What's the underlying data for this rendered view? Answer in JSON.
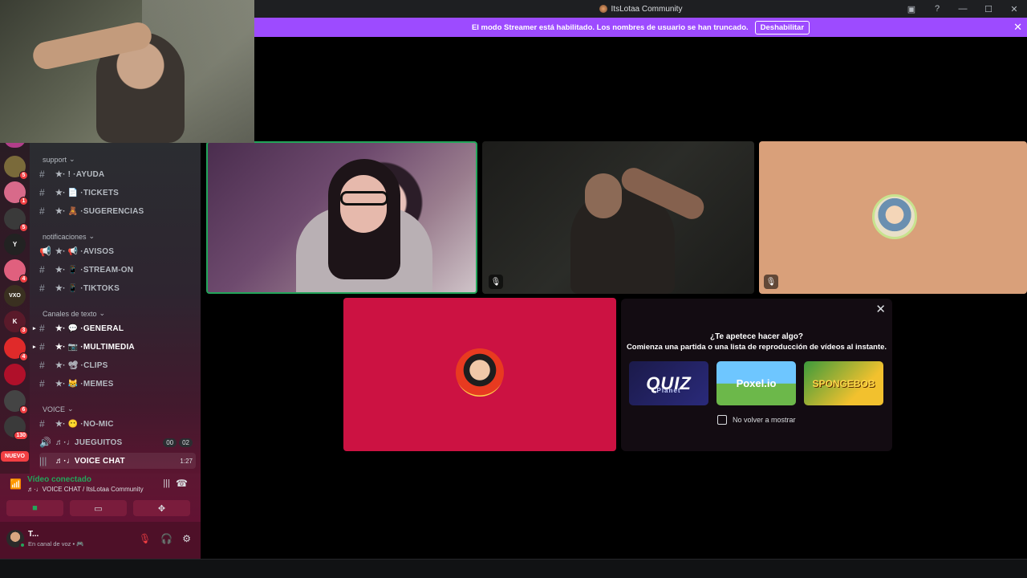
{
  "window": {
    "title": "ItsLotaa Community"
  },
  "banner": {
    "message": "El modo Streamer está habilitado. Los nombres de usuario se han truncado.",
    "button": "Deshabilitar"
  },
  "server_rail": {
    "servers": [
      {
        "initials": "",
        "badge": "",
        "color": "#b23e8a"
      },
      {
        "initials": "",
        "badge": "5",
        "color": "#7a6a3a"
      },
      {
        "initials": "",
        "badge": "1",
        "color": "#d86a8a"
      },
      {
        "initials": "",
        "badge": "5",
        "color": "#3a3a3a"
      },
      {
        "initials": "Y",
        "badge": "",
        "color": "#222222"
      },
      {
        "initials": "",
        "badge": "4",
        "color": "#e0607e"
      },
      {
        "initials": "VXO",
        "badge": "",
        "color": "#3a3020"
      },
      {
        "initials": "K",
        "badge": "3",
        "color": "#5a1a2a"
      },
      {
        "initials": "",
        "badge": "4",
        "color": "#e02a2a"
      },
      {
        "initials": "",
        "badge": "",
        "color": "#b0102a"
      },
      {
        "initials": "",
        "badge": "6",
        "color": "#444444"
      },
      {
        "initials": "",
        "badge": "130",
        "color": "#3a3a3a"
      }
    ],
    "new_label": "NUEVO"
  },
  "sidebar": {
    "categories": {
      "support": "support",
      "notificaciones": "notificaciones",
      "texto": "Canales de texto",
      "voice": "VOICE"
    },
    "channels": {
      "ayuda": "★·‎ ! ·AYUDA",
      "tickets": "★·‎ 📄 ·TICKETS",
      "sugerencias": "★·‎ 🧸 ·SUGERENCIAS",
      "avisos": "★·‎ 📢 ·AVISOS",
      "stream": "★·‎ 📱 ·STREAM-ON",
      "tiktoks": "★·‎ 📱 ·TIKTOKS",
      "general": "★·‎ 💬 ·GENERAL",
      "multimedia": "★·‎ 📷 ·MULTIMEDIA",
      "clips": "★·‎ 📽 ·CLIPS",
      "memes": "★·‎ 😹 ·MEMES",
      "nomic": "★·‎ 😶 ·NO-MIC",
      "jueguitos": "♬·♩JUEGUITOS",
      "voicechat": "♬·♩VOICE CHAT"
    },
    "jueguitos_counts": [
      "00",
      "02"
    ],
    "voicechat_timer": "1:27"
  },
  "voice": {
    "state": "Vídeo conectado",
    "location": "♬·♩VOICE CHAT / ItsLotaa Community"
  },
  "user": {
    "name": "T...",
    "status": "En canal de voz • 🎮"
  },
  "activity": {
    "question": "¿Te apetece hacer algo?",
    "subtitle": "Comienza una partida o una lista de reproducción de vídeos al instante.",
    "games": [
      {
        "name": "QUIZ",
        "tag": "Planet"
      },
      {
        "name": "Poxel.io"
      },
      {
        "name": "SPONGEBOB"
      }
    ],
    "dont_show": "No volver a mostrar"
  },
  "colors": {
    "banner": "#9d4bff",
    "speaking_border": "#23a55a",
    "tile_pink": "#cc1242",
    "tile_peach": "#d9a07a"
  }
}
